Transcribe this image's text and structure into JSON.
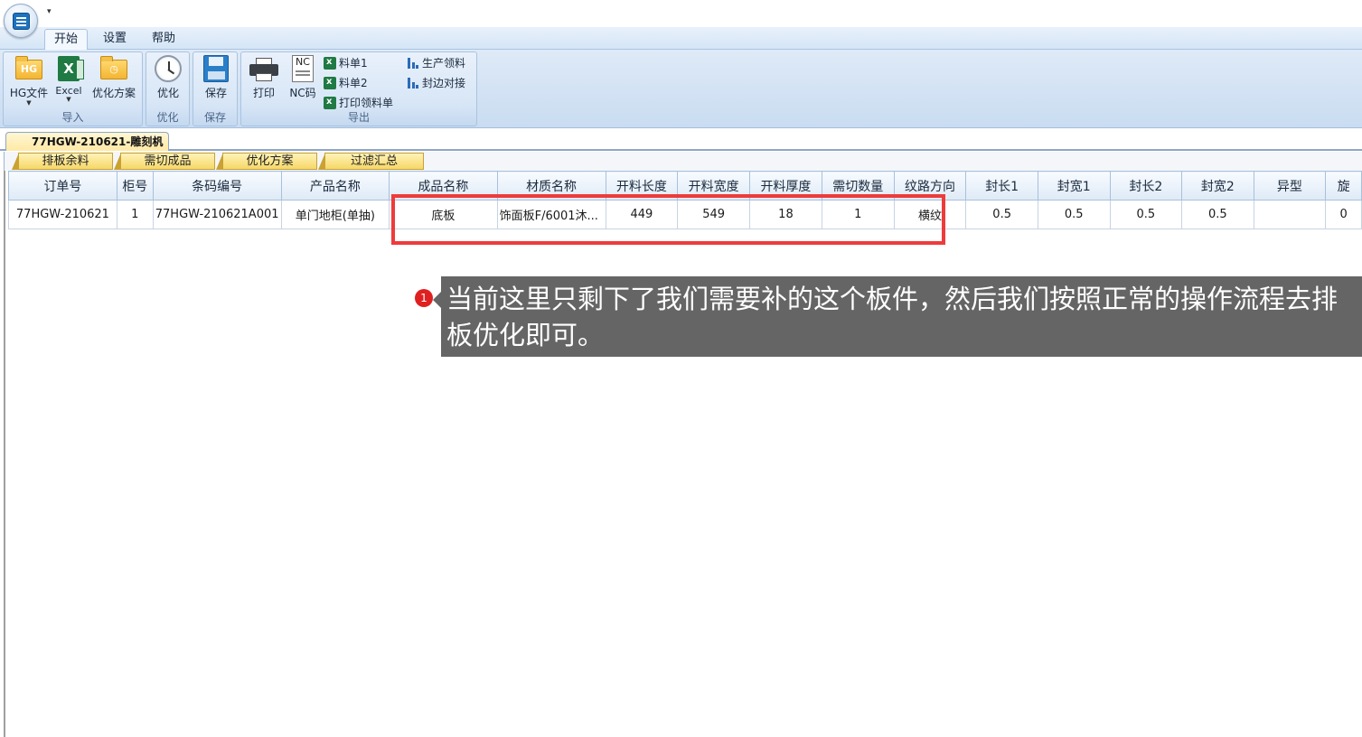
{
  "ribbon": {
    "tabs": [
      "开始",
      "设置",
      "帮助"
    ],
    "groups": {
      "import": {
        "label": "导入",
        "hg_file": "HG文件",
        "hg_badge": "HG",
        "excel": "Excel",
        "excel_glyph": "X",
        "plan": "优化方案"
      },
      "optimize": {
        "label": "优化",
        "optimize": "优化"
      },
      "save": {
        "label": "保存",
        "save": "保存"
      },
      "export": {
        "label": "导出",
        "print": "打印",
        "nc_code": "NC码",
        "nc_badge": "NC",
        "bom1": "料单1",
        "bom2": "料单2",
        "print_picking": "打印领料单",
        "production_picking": "生产领料",
        "edge_joint": "封边对接"
      }
    }
  },
  "document_tab": {
    "title": "77HGW-210621-雕刻机",
    "close": "×"
  },
  "sub_tabs": [
    "排板余料",
    "需切成品",
    "优化方案",
    "过滤汇总"
  ],
  "grid": {
    "columns": [
      "订单号",
      "柜号",
      "条码编号",
      "产品名称",
      "成品名称",
      "材质名称",
      "开料长度",
      "开料宽度",
      "开料厚度",
      "需切数量",
      "纹路方向",
      "封长1",
      "封宽1",
      "封长2",
      "封宽2",
      "异型",
      "旋"
    ],
    "rows": [
      [
        "77HGW-210621",
        "1",
        "77HGW-210621A001",
        "单门地柜(单抽)",
        "底板",
        "饰面板F/6001沐...",
        "449",
        "549",
        "18",
        "1",
        "横纹",
        "0.5",
        "0.5",
        "0.5",
        "0.5",
        "",
        "0"
      ]
    ]
  },
  "annotation": {
    "step": "1",
    "text": "当前这里只剩下了我们需要补的这个板件，然后我们按照正常的操作流程去排板优化即可。"
  },
  "colors": {
    "highlight": "#ee3b3b",
    "callout_bg": "#656565",
    "ribbon": "#d5e5f6"
  }
}
